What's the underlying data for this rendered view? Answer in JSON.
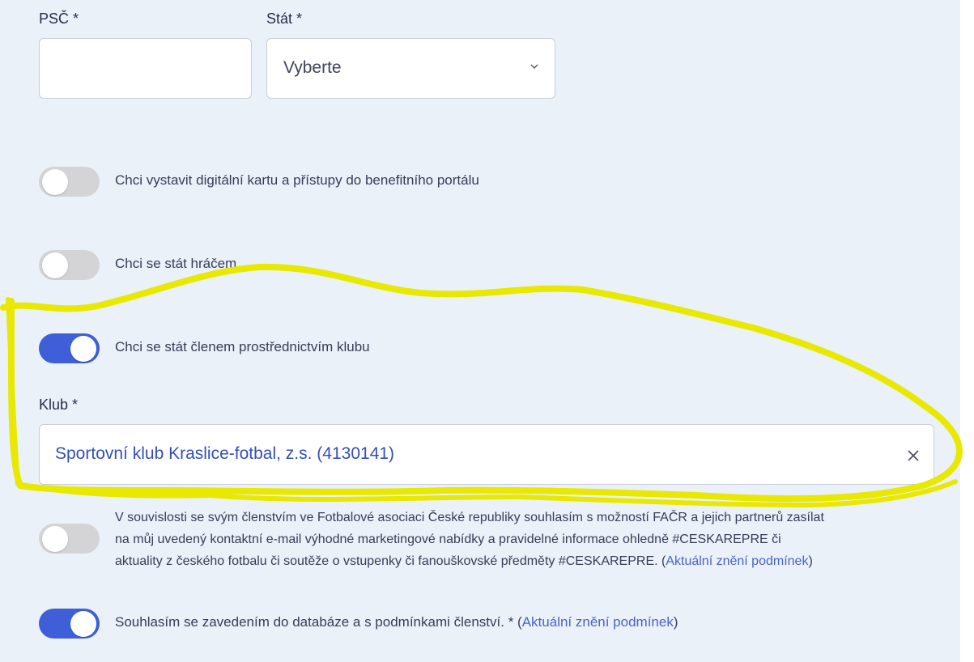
{
  "address": {
    "psc_label": "PSČ *",
    "psc_value": "",
    "state_label": "Stát *",
    "state_value": "Vyberte"
  },
  "toggles": {
    "digital_card": {
      "label": "Chci vystavit digitální kartu a přístupy do benefitního portálu",
      "on": false
    },
    "player": {
      "label": "Chci se stát hráčem",
      "on": false
    },
    "club_member": {
      "label": "Chci se stát členem prostřednictvím klubu",
      "on": true
    }
  },
  "club": {
    "label": "Klub *",
    "value": "Sportovní klub Kraslice-fotbal, z.s. (4130141)"
  },
  "marketing": {
    "on": false,
    "line1": "V souvislosti se svým členstvím ve Fotbalové asociaci České republiky souhlasím s možností FAČR a jejich partnerů zasílat",
    "line2": "na můj uvedený kontaktní e-mail výhodné marketingové nabídky a pravidelné informace ohledně #CESKAREPRE či",
    "line3_text": "aktuality z českého fotbalu či soutěže o vstupenky či fanouškovské předměty #CESKAREPRE. (",
    "link": "Aktuální znění podmínek",
    "line3_end": ")"
  },
  "consent": {
    "on": true,
    "text": "Souhlasím se zavedením do databáze a s podmínkami členství. * (",
    "link": "Aktuální znění podmínek",
    "end": ")"
  },
  "colors": {
    "background": "#eaf1f9",
    "toggle_on": "#3e5fd8",
    "toggle_off": "#d4d4d6",
    "link": "#4b63c6",
    "highlight": "#e8e800"
  }
}
